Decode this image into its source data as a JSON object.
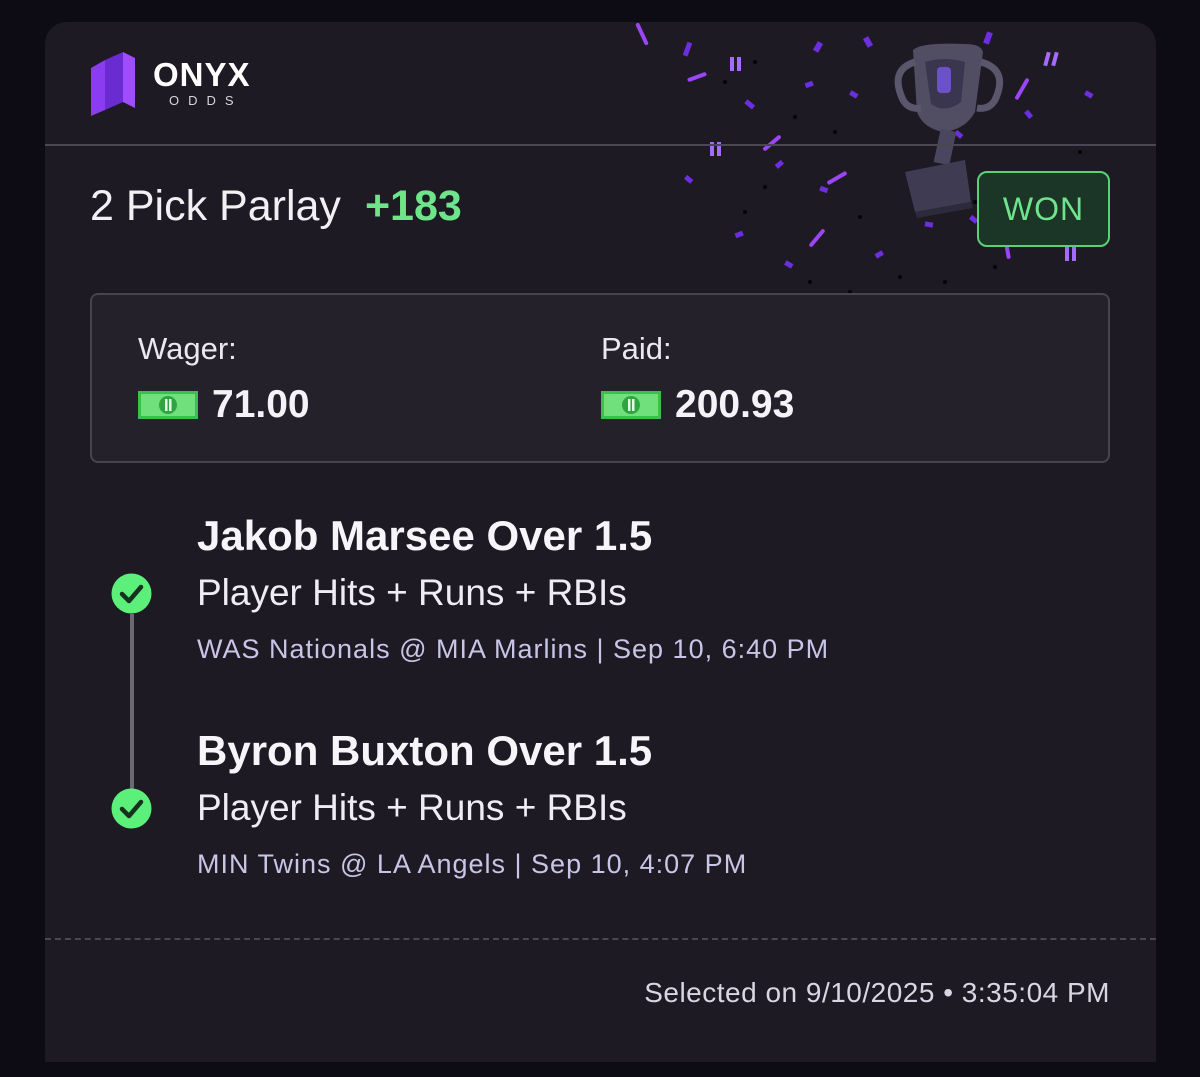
{
  "brand": {
    "name": "ONYX",
    "sub": "ODDS"
  },
  "bet": {
    "title": "2 Pick Parlay",
    "odds": "+183",
    "status": "WON"
  },
  "wager": {
    "label": "Wager:",
    "amount": "71.00"
  },
  "paid": {
    "label": "Paid:",
    "amount": "200.93"
  },
  "legs": [
    {
      "title": "Jakob Marsee Over 1.5",
      "market": "Player Hits + Runs + RBIs",
      "game": "WAS Nationals @ MIA Marlins | Sep 10, 6:40 PM",
      "result": "win"
    },
    {
      "title": "Byron Buxton Over 1.5",
      "market": "Player Hits + Runs + RBIs",
      "game": "MIN Twins @ LA Angels | Sep 10, 4:07 PM",
      "result": "win"
    }
  ],
  "footer": {
    "selected": "Selected on 9/10/2025 • 3:35:04 PM"
  },
  "icons": {
    "logo": "onyx-logo-icon",
    "trophy": "trophy-icon",
    "check": "check-circle-icon",
    "bill": "cash-icon"
  },
  "colors": {
    "background": "#0d0c14",
    "card": "#1d1a23",
    "accent_green": "#6ee58a",
    "brand_purple": "#8a3ff5",
    "muted_text": "#c9c5e6"
  }
}
